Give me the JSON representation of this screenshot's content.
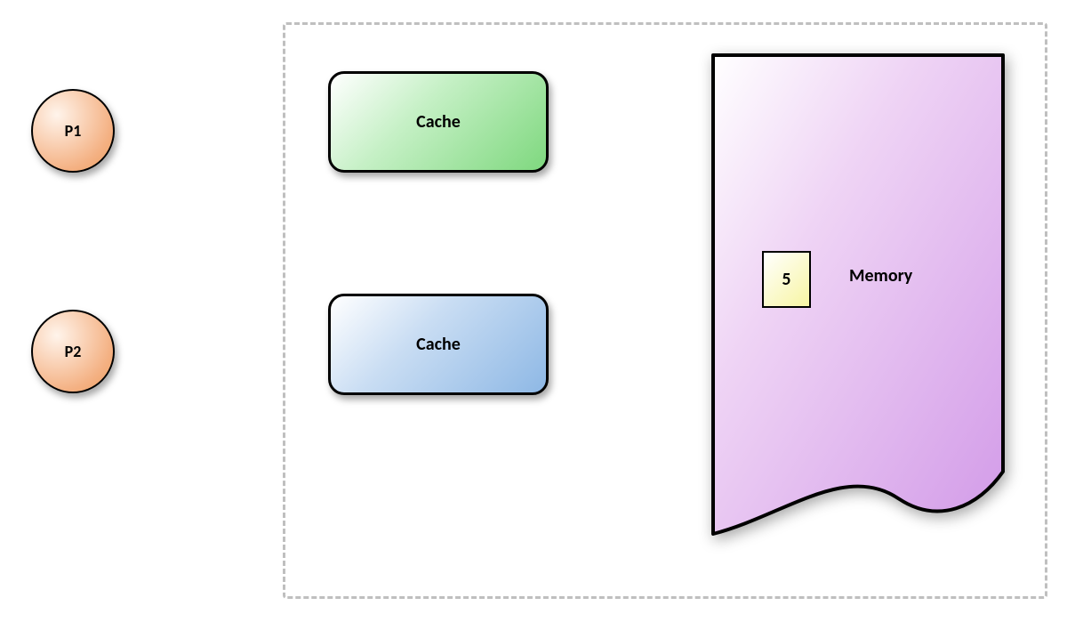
{
  "processors": {
    "p1": "P1",
    "p2": "P2"
  },
  "caches": {
    "cache1": "Cache",
    "cache2": "Cache"
  },
  "memory": {
    "label": "Memory",
    "value": "5"
  }
}
